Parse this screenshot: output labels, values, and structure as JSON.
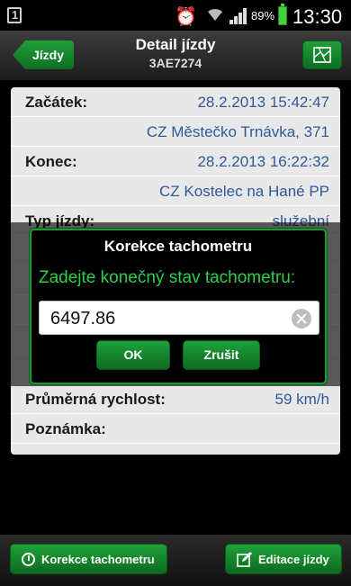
{
  "status_bar": {
    "battery_percent": "89%",
    "time": "13:30",
    "icons": [
      "sim-icon",
      "alarm-icon",
      "wifi-icon",
      "signal-icon",
      "battery-icon"
    ]
  },
  "header": {
    "back_label": "Jízdy",
    "title": "Detail jízdy",
    "subtitle": "3AE7274",
    "map_icon": "map-icon"
  },
  "details": {
    "start_label": "Začátek:",
    "start_time": "28.2.2013 15:42:47",
    "start_place": "CZ Městečko Trnávka, 371",
    "end_label": "Konec:",
    "end_time": "28.2.2013 16:22:32",
    "end_place": "CZ Kostelec na Hané PP",
    "type_label": "Typ jízdy:",
    "type_value": "služební",
    "avg_speed_label": "Průměrná rychlost:",
    "avg_speed_value": "59 km/h",
    "note_label": "Poznámka:"
  },
  "dialog": {
    "title": "Korekce tachometru",
    "message": "Zadejte konečný stav tachometru:",
    "input_value": "6497.86",
    "ok_label": "OK",
    "cancel_label": "Zrušit"
  },
  "footer": {
    "tacho_label": "Korekce tachometru",
    "edit_label": "Editace jízdy"
  },
  "colors": {
    "accent_green": "#1b9b34",
    "value_blue": "#2e5a9a",
    "dialog_text_green": "#2dcf4c"
  }
}
